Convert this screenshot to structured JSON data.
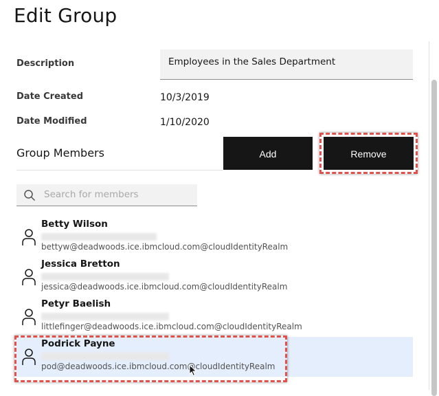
{
  "page": {
    "title": "Edit Group"
  },
  "fields": {
    "description_label": "Description",
    "description_value": "Employees in the Sales Department",
    "created_label": "Date Created",
    "created_value": "10/3/2019",
    "modified_label": "Date Modified",
    "modified_value": "1/10/2020"
  },
  "members_section": {
    "title": "Group Members",
    "add_label": "Add",
    "remove_label": "Remove",
    "search_placeholder": "Search for members"
  },
  "members": [
    {
      "name": "Betty Wilson",
      "email": "bettyw@deadwoods.ice.ibmcloud.com@cloudIdentityRealm",
      "selected": false
    },
    {
      "name": "Jessica Bretton",
      "email": "jessica@deadwoods.ice.ibmcloud.com@cloudIdentityRealm",
      "selected": false
    },
    {
      "name": "Petyr Baelish",
      "email": "littlefinger@deadwoods.ice.ibmcloud.com@cloudIdentityRealm",
      "selected": false
    },
    {
      "name": "Podrick Payne",
      "email": "pod@deadwoods.ice.ibmcloud.com@cloudIdentityRealm",
      "selected": true
    }
  ],
  "icons": {
    "search": "search-icon",
    "user": "user-icon",
    "cursor": "mouse-cursor-icon"
  },
  "colors": {
    "button_bg": "#161616",
    "selected_row": "#e5eefc",
    "highlight_border": "#e0524b"
  }
}
